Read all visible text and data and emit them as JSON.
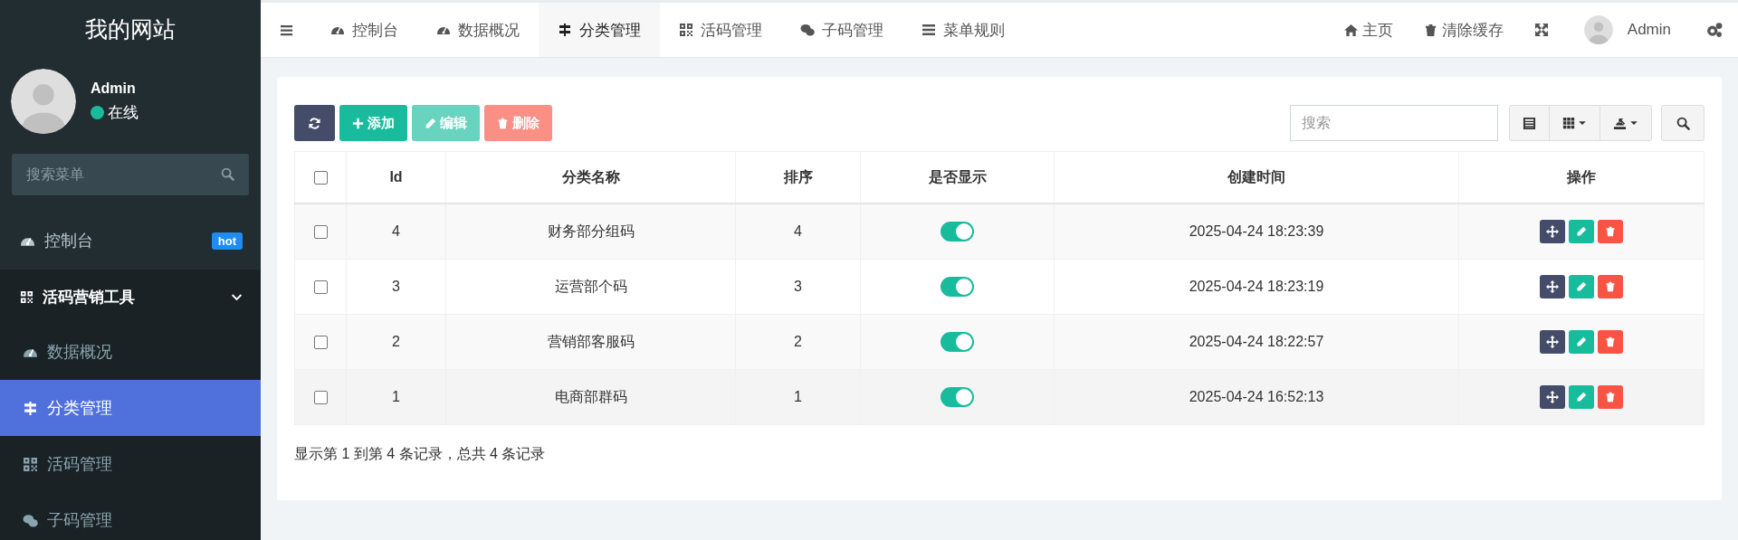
{
  "sidebar": {
    "title": "我的网站",
    "user": {
      "name": "Admin",
      "status": "在线",
      "online": true
    },
    "search": {
      "placeholder": "搜索菜单"
    },
    "items": [
      {
        "label": "控制台",
        "badge": "hot",
        "selected": false
      },
      {
        "label": "活码营销工具",
        "expanded": true,
        "children": [
          {
            "label": "数据概况",
            "selected": false
          },
          {
            "label": "分类管理",
            "selected": true
          },
          {
            "label": "活码管理",
            "selected": false
          },
          {
            "label": "子码管理",
            "selected": false
          }
        ]
      }
    ]
  },
  "topbar": {
    "tabs": [
      {
        "label": "控制台",
        "selected": false
      },
      {
        "label": "数据概况",
        "selected": false
      },
      {
        "label": "分类管理",
        "selected": true
      },
      {
        "label": "活码管理",
        "selected": false
      },
      {
        "label": "子码管理",
        "selected": false
      },
      {
        "label": "菜单规则",
        "selected": false
      }
    ],
    "links": [
      {
        "kind": "link",
        "label": "主页"
      },
      {
        "kind": "link",
        "label": "清除缓存"
      },
      {
        "kind": "fullscreen"
      },
      {
        "kind": "user",
        "label": "Admin"
      },
      {
        "kind": "settings"
      }
    ]
  },
  "toolbar": {
    "buttons": [
      {
        "kind": "refresh",
        "disabled": false
      },
      {
        "kind": "add",
        "label": "添加",
        "disabled": false
      },
      {
        "kind": "edit",
        "label": "编辑",
        "disabled": true
      },
      {
        "kind": "delete",
        "label": "删除",
        "disabled": true
      }
    ],
    "search": {
      "placeholder": "搜索"
    }
  },
  "table": {
    "header_checked": false,
    "columns": [
      "Id",
      "分类名称",
      "排序",
      "是否显示",
      "创建时间",
      "操作"
    ],
    "rows": [
      {
        "checked": false,
        "id": "4",
        "name": "财务部分组码",
        "order": "4",
        "shown": true,
        "created": "2025-04-24 18:23:39"
      },
      {
        "checked": false,
        "id": "3",
        "name": "运营部个码",
        "order": "3",
        "shown": true,
        "created": "2025-04-24 18:23:19"
      },
      {
        "checked": false,
        "id": "2",
        "name": "营销部客服码",
        "order": "2",
        "shown": true,
        "created": "2025-04-24 18:22:57"
      },
      {
        "checked": false,
        "id": "1",
        "name": "电商部群码",
        "order": "1",
        "shown": true,
        "created": "2025-04-24 16:52:13"
      }
    ]
  },
  "pagination": {
    "summary": "显示第 1 到第 4 条记录，总共 4 条记录"
  }
}
